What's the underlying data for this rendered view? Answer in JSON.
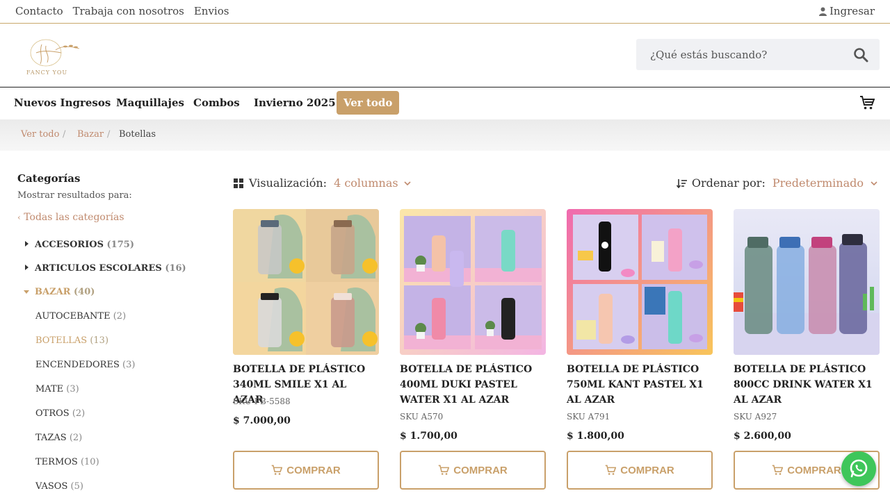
{
  "topbar": {
    "links": [
      "Contacto",
      "Trabaja con nosotros",
      "Envios"
    ],
    "login_label": "Ingresar"
  },
  "logo": {
    "text": "FANCY YOU"
  },
  "search": {
    "placeholder": "¿Qué estás buscando?"
  },
  "nav": {
    "items": [
      "Nuevos Ingresos",
      "Maquillajes",
      "Combos",
      "Invierno 2025"
    ],
    "cta_label": "Ver todo"
  },
  "breadcrumb": [
    "Ver todo",
    "Bazar",
    "Botellas"
  ],
  "sidebar": {
    "title": "Categorías",
    "subtitle": "Mostrar resultados para:",
    "all_label": "Todas las categorías",
    "categories": [
      {
        "label": "ACCESORIOS",
        "count": "(175)"
      },
      {
        "label": "ARTICULOS ESCOLARES",
        "count": "(16)"
      },
      {
        "label": "BAZAR",
        "count": "(40)"
      }
    ],
    "subcategories": [
      {
        "label": "AUTOCEBANTE",
        "count": "(2)"
      },
      {
        "label": "BOTELLAS",
        "count": "(13)"
      },
      {
        "label": "ENCENDEDORES",
        "count": "(3)"
      },
      {
        "label": "MATE",
        "count": "(3)"
      },
      {
        "label": "OTROS",
        "count": "(2)"
      },
      {
        "label": "TAZAS",
        "count": "(2)"
      },
      {
        "label": "TERMOS",
        "count": "(10)"
      },
      {
        "label": "VASOS",
        "count": "(5)"
      }
    ]
  },
  "toolbar": {
    "view_label": "Visualización:",
    "view_value": "4 columnas",
    "sort_label": "Ordenar por:",
    "sort_value": "Predeterminado"
  },
  "products": [
    {
      "name": "BOTELLA DE PLÁSTICO 340ML SMILE X1 AL AZAR",
      "sku": "SKU FB-5588",
      "price": "$  7.000,00",
      "buy_label": "COMPRAR"
    },
    {
      "name": "BOTELLA DE PLÁSTICO 400ML DUKI PASTEL WATER X1 AL AZAR",
      "sku": "SKU A570",
      "price": "$  1.700,00",
      "buy_label": "COMPRAR"
    },
    {
      "name": "BOTELLA DE PLÁSTICO 750ML KANT PASTEL X1 AL AZAR",
      "sku": "SKU A791",
      "price": "$  1.800,00",
      "buy_label": "COMPRAR"
    },
    {
      "name": "BOTELLA DE PLÁSTICO 800CC DRINK WATER X1 AL AZAR",
      "sku": "SKU A927",
      "price": "$  2.600,00",
      "buy_label": "COMPRAR"
    }
  ],
  "colors": {
    "accent": "#c9a06a",
    "link": "#c08a6e",
    "whatsapp": "#3ec65a"
  }
}
